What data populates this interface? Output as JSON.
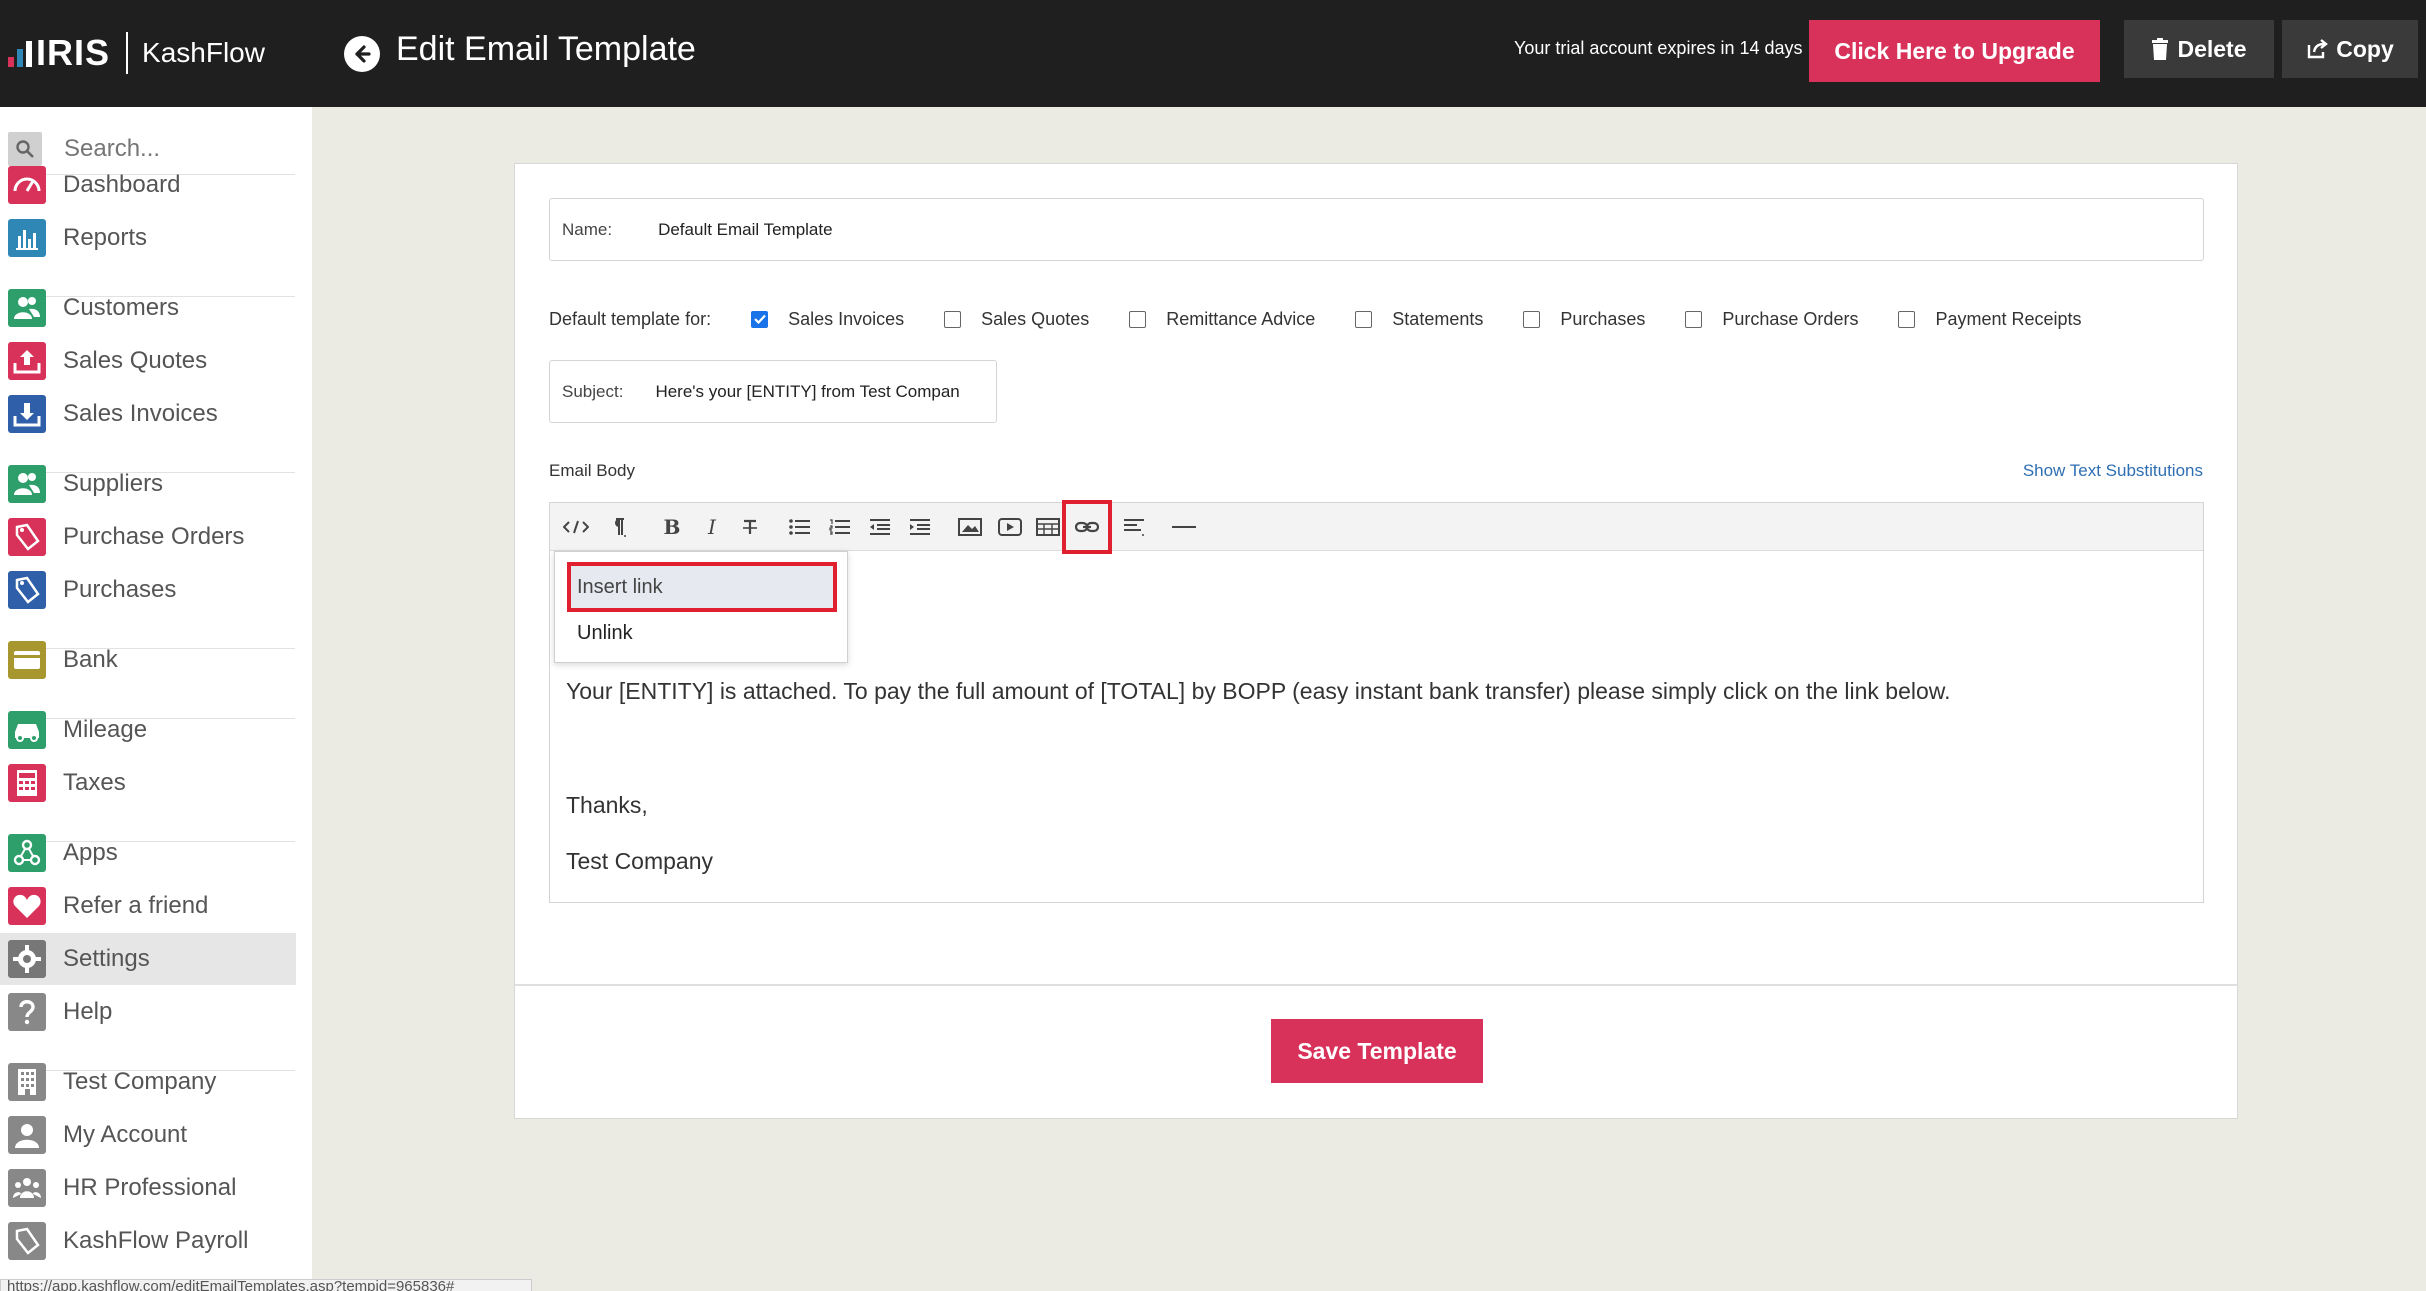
{
  "header": {
    "brand_iris": "IRIS",
    "brand_kashflow": "KashFlow",
    "page_title": "Edit Email Template",
    "trial_notice": "Your trial account expires in 14 days",
    "upgrade_label": "Click Here to Upgrade",
    "delete_label": "Delete",
    "copy_label": "Copy"
  },
  "colors": {
    "accent": "#d8325a",
    "topbar": "#1f1f1f",
    "link": "#2f6eb3",
    "highlight_border": "#e0202f"
  },
  "sidebar": {
    "search_placeholder": "Search...",
    "items": [
      {
        "label": "Dashboard",
        "icon": "speedometer-icon",
        "color": "#d8325a"
      },
      {
        "label": "Reports",
        "icon": "bar-chart-icon",
        "color": "#2e87b5"
      },
      {
        "label": "Customers",
        "icon": "people-icon",
        "color": "#2e9e6b"
      },
      {
        "label": "Sales Quotes",
        "icon": "upload-tray-icon",
        "color": "#d8325a"
      },
      {
        "label": "Sales Invoices",
        "icon": "download-tray-icon",
        "color": "#2e5fa8"
      },
      {
        "label": "Suppliers",
        "icon": "people-icon",
        "color": "#2e9e6b"
      },
      {
        "label": "Purchase Orders",
        "icon": "tag-icon",
        "color": "#d8325a"
      },
      {
        "label": "Purchases",
        "icon": "tag-icon",
        "color": "#2e5fa8"
      },
      {
        "label": "Bank",
        "icon": "credit-card-icon",
        "color": "#a8962e"
      },
      {
        "label": "Mileage",
        "icon": "car-icon",
        "color": "#2e9e6b"
      },
      {
        "label": "Taxes",
        "icon": "calculator-icon",
        "color": "#d8325a"
      },
      {
        "label": "Apps",
        "icon": "apps-network-icon",
        "color": "#2e9e6b"
      },
      {
        "label": "Refer a friend",
        "icon": "heart-icon",
        "color": "#d8325a"
      },
      {
        "label": "Settings",
        "icon": "gear-icon",
        "color": "#777777"
      },
      {
        "label": "Help",
        "icon": "question-icon",
        "color": "#888888"
      },
      {
        "label": "Test Company",
        "icon": "building-icon",
        "color": "#888888"
      },
      {
        "label": "My Account",
        "icon": "user-icon",
        "color": "#888888"
      },
      {
        "label": "HR Professional",
        "icon": "group-icon",
        "color": "#888888"
      },
      {
        "label": "KashFlow Payroll",
        "icon": "payroll-icon",
        "color": "#888888"
      }
    ]
  },
  "form": {
    "name_label": "Name:",
    "name_value": "Default Email Template",
    "default_for_label": "Default template for:",
    "template_types": [
      {
        "label": "Sales Invoices",
        "checked": true
      },
      {
        "label": "Sales Quotes",
        "checked": false
      },
      {
        "label": "Remittance Advice",
        "checked": false
      },
      {
        "label": "Statements",
        "checked": false
      },
      {
        "label": "Purchases",
        "checked": false
      },
      {
        "label": "Purchase Orders",
        "checked": false
      },
      {
        "label": "Payment Receipts",
        "checked": false
      }
    ],
    "subject_label": "Subject:",
    "subject_value": "Here's your [ENTITY] from Test Compan",
    "email_body_label": "Email Body",
    "show_substitutions": "Show Text Substitutions",
    "toolbar_icons": [
      "code-view-icon",
      "paragraph-icon",
      "bold-icon",
      "italic-icon",
      "strikethrough-icon",
      "bullet-list-icon",
      "numbered-list-icon",
      "outdent-icon",
      "indent-icon",
      "image-icon",
      "video-icon",
      "table-icon",
      "link-icon",
      "align-icon",
      "horizontal-rule-icon"
    ],
    "link_menu": {
      "insert": "Insert link",
      "unlink": "Unlink"
    },
    "body_lines": {
      "line1": "Your [ENTITY] is attached. To pay the full amount of [TOTAL] by BOPP (easy instant bank transfer) please simply click on the link below.",
      "line2": "Thanks,",
      "line3": "Test Company"
    },
    "save_label": "Save Template"
  },
  "status_bar": {
    "url": "https://app.kashflow.com/editEmailTemplates.asp?tempid=965836#"
  }
}
